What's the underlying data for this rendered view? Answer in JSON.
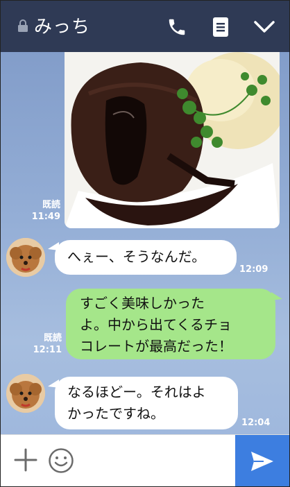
{
  "header": {
    "title": "みっち",
    "icons": [
      "lock-icon",
      "phone-icon",
      "memo-icon",
      "chevron-down-icon"
    ]
  },
  "messages": [
    {
      "type": "image",
      "side": "right",
      "read_label": "既読",
      "time": "11:49",
      "image_desc": "chocolate-fondant-photo"
    },
    {
      "type": "text",
      "side": "left",
      "lines": [
        "へぇー、そうなんだ。"
      ],
      "time": "12:09"
    },
    {
      "type": "text",
      "side": "right",
      "lines": [
        "すごく美味しかった",
        "よ。中から出てくるチョ",
        "コレートが最高だった！"
      ],
      "read_label": "既読",
      "time": "12:11"
    },
    {
      "type": "text",
      "side": "left",
      "lines": [
        "なるほどー。それはよ",
        "かったですね。"
      ],
      "time": "12:04"
    }
  ],
  "inputbar": {
    "icons": [
      "plus-icon",
      "emoji-icon",
      "send-icon"
    ],
    "send_color": "#3d7ee0"
  },
  "colors": {
    "header": "#2f3a55",
    "outgoing_bubble": "#a5e68a",
    "incoming_bubble": "#ffffff"
  }
}
